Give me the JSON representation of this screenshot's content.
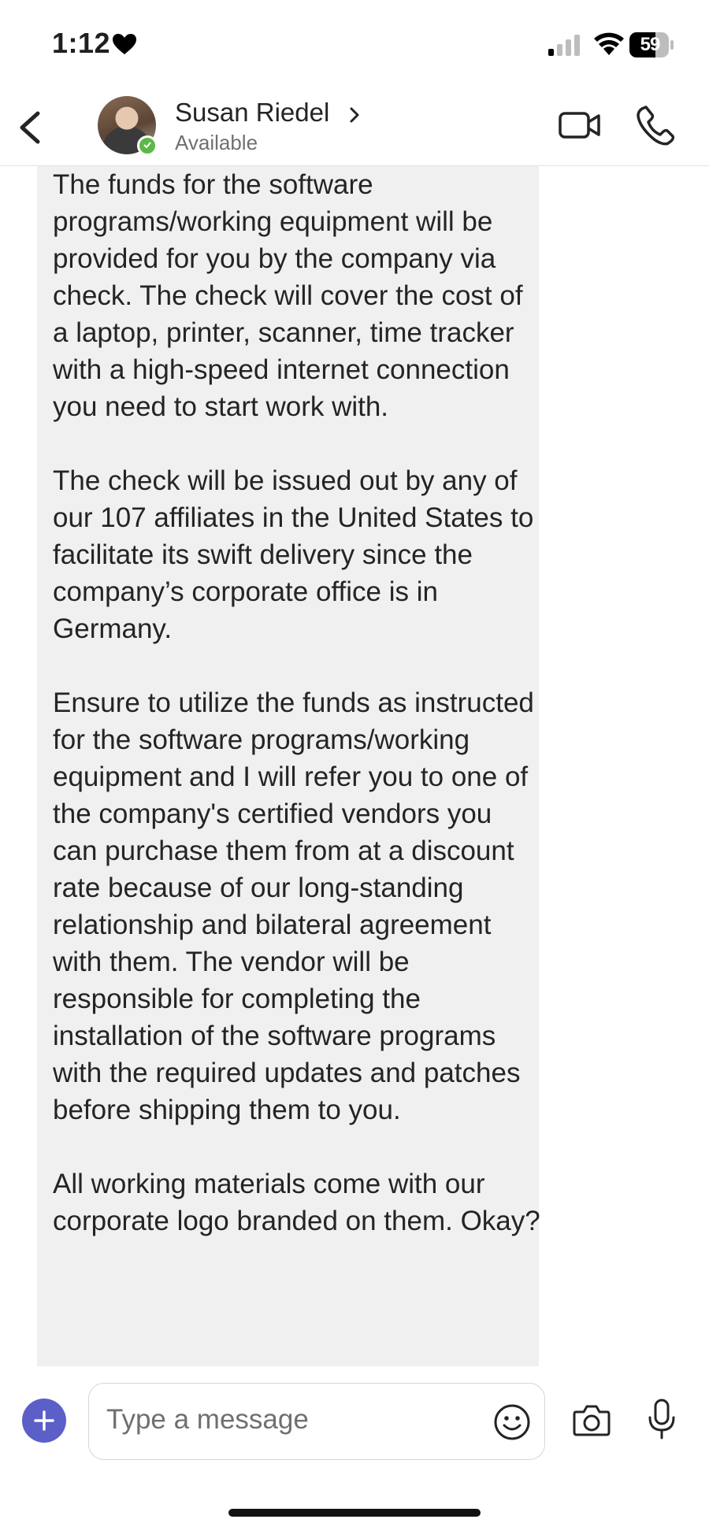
{
  "status_bar": {
    "time": "1:12",
    "battery": "59",
    "icons": [
      "heart-icon",
      "signal-icon",
      "wifi-icon",
      "battery-icon"
    ]
  },
  "header": {
    "contact_name": "Susan Riedel",
    "contact_status": "Available",
    "icons": [
      "back-icon",
      "chevron-right-icon",
      "video-camera-icon",
      "phone-icon"
    ],
    "presence_color": "#5db84a"
  },
  "message": {
    "paragraphs": [
      "The funds for the software programs/working equipment will be provided for you by the company via check. The check will cover the cost of a laptop, printer, scanner, time tracker with a high-speed internet connection you need to start work with.",
      "The check will be issued out by any of our 107 affiliates in the United States to facilitate its swift delivery since the company’s corporate office is in Germany.",
      "Ensure to utilize the funds as instructed for the software programs/working equipment and I will refer you to one of the company's certified vendors you can purchase them from at a discount rate because of our long-standing relationship and bilateral agreement with them. The vendor will be responsible for completing the installation of the software programs with the required updates and patches before shipping them to you.",
      "All working materials come with our corporate logo branded on them. Okay?"
    ]
  },
  "composer": {
    "placeholder": "Type a message",
    "accent_color": "#5b5fc7",
    "icons": [
      "plus-icon",
      "emoji-icon",
      "camera-icon",
      "microphone-icon"
    ]
  }
}
